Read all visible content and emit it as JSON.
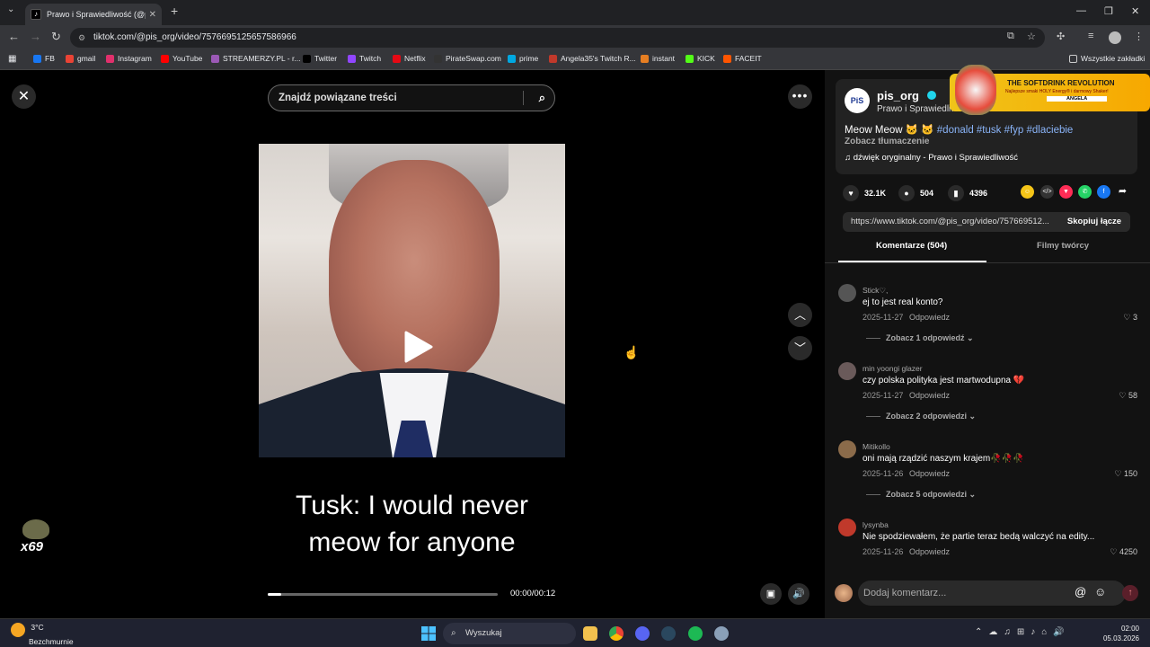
{
  "browser": {
    "tab_title": "Prawo i Sprawiedliwość (@pis_...",
    "tab_favicon": "tiktok-icon",
    "url": "tiktok.com/@pis_org/video/7576695125657586966",
    "bookmarks": [
      {
        "label": "FB",
        "color": "#1877f2"
      },
      {
        "label": "gmail",
        "color": "#ea4335"
      },
      {
        "label": "Instagram",
        "color": "#e1306c"
      },
      {
        "label": "YouTube",
        "color": "#ff0000"
      },
      {
        "label": "STREAMERZY.PL - r...",
        "color": "#9b59b6"
      },
      {
        "label": "Twitter",
        "color": "#000000"
      },
      {
        "label": "Twitch",
        "color": "#9146ff"
      },
      {
        "label": "Netflix",
        "color": "#e50914"
      },
      {
        "label": "PirateSwap.com",
        "color": "#333333"
      },
      {
        "label": "prime",
        "color": "#00a8e1"
      },
      {
        "label": "Angela35's Twitch R...",
        "color": "#c0392b"
      },
      {
        "label": "instant",
        "color": "#e67e22"
      },
      {
        "label": "KICK",
        "color": "#53fc18"
      },
      {
        "label": "FACEIT",
        "color": "#ff5500"
      }
    ],
    "all_bookmarks": "Wszystkie zakładki"
  },
  "player": {
    "search_placeholder": "Znajdź powiązane treści",
    "caption_line1": "Tusk: I would never",
    "caption_line2": "meow for anyone",
    "timecode": "00:00/00:12",
    "progress": 0.06,
    "sticker_text": "x69"
  },
  "post": {
    "username": "pis_org",
    "nickname": "Prawo i Sprawiedliwość",
    "desc_text": "Meow Meow 🐱 🐱 ",
    "hashtags": "#donald #tusk #fyp #dlaciebie",
    "translate": "Zobacz tłumaczenie",
    "sound": "dźwięk oryginalny - Prawo i Sprawiedliwość",
    "likes": "32.1K",
    "comments_count": "504",
    "saves": "4396",
    "share_url": "https://www.tiktok.com/@pis_org/video/757669512...",
    "copy_label": "Skopiuj łącze",
    "ad_title": "THE SOFTDRINK REVOLUTION",
    "ad_sub": "Najlepsze smaki HOLY Energy® i darmowy Shaker!",
    "ad_name": "ANGELA"
  },
  "tabs": {
    "comments": "Komentarze (504)",
    "creator": "Filmy twórcy"
  },
  "comments": [
    {
      "user": "Stick♡,",
      "text": "ej to jest real konto?",
      "date": "2025-11-27",
      "reply": "Odpowiedz",
      "likes": "3",
      "more": "Zobacz 1 odpowiedź",
      "avatar": "#555"
    },
    {
      "user": "min yoongi glazer",
      "text": "czy polska polityka jest martwodupna 💔",
      "date": "2025-11-27",
      "reply": "Odpowiedz",
      "likes": "58",
      "more": "Zobacz 2 odpowiedzi",
      "avatar": "#6a5a5a"
    },
    {
      "user": "Mitikollo",
      "text": "oni mają rządzić naszym krajem🥀🥀🥀",
      "date": "2025-11-26",
      "reply": "Odpowiedz",
      "likes": "150",
      "more": "Zobacz 5 odpowiedzi",
      "avatar": "#8b6b4a"
    },
    {
      "user": "lysynba",
      "text": "Nie spodziewałem, że partie teraz bedą walczyć na edity...",
      "date": "2025-11-26",
      "reply": "Odpowiedz",
      "likes": "4250",
      "more": "",
      "avatar": "#c0392b"
    }
  ],
  "comment_input": {
    "placeholder": "Dodaj komentarz..."
  },
  "taskbar": {
    "temp": "3°C",
    "weather": "Bezchmurnie",
    "search": "Wyszukaj",
    "time": "02:00",
    "date": "05.03.2026"
  }
}
